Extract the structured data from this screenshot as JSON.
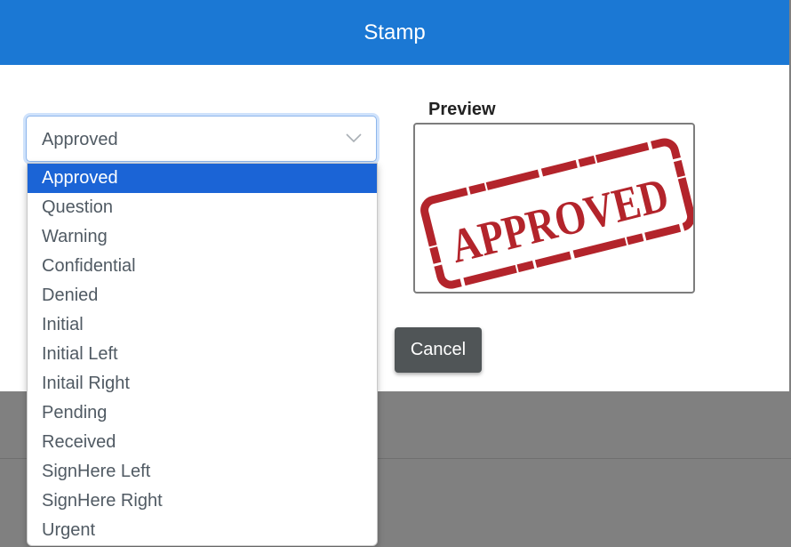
{
  "dialog": {
    "title": "Stamp",
    "select": {
      "value": "Approved",
      "options": [
        "Approved",
        "Question",
        "Warning",
        "Confidential",
        "Denied",
        "Initial",
        "Initial Left",
        "Initail Right",
        "Pending",
        "Received",
        "SignHere Left",
        "SignHere Right",
        "Urgent"
      ],
      "selected_index": 0
    },
    "preview": {
      "label": "Preview",
      "stamp_text": "APPROVED",
      "stamp_color": "#b3242b"
    },
    "cancel_label": "Cancel"
  },
  "colors": {
    "header": "#1b78d4",
    "selected_option": "#1b64d6",
    "overlay": "#808080",
    "cancel_button": "#505557"
  }
}
